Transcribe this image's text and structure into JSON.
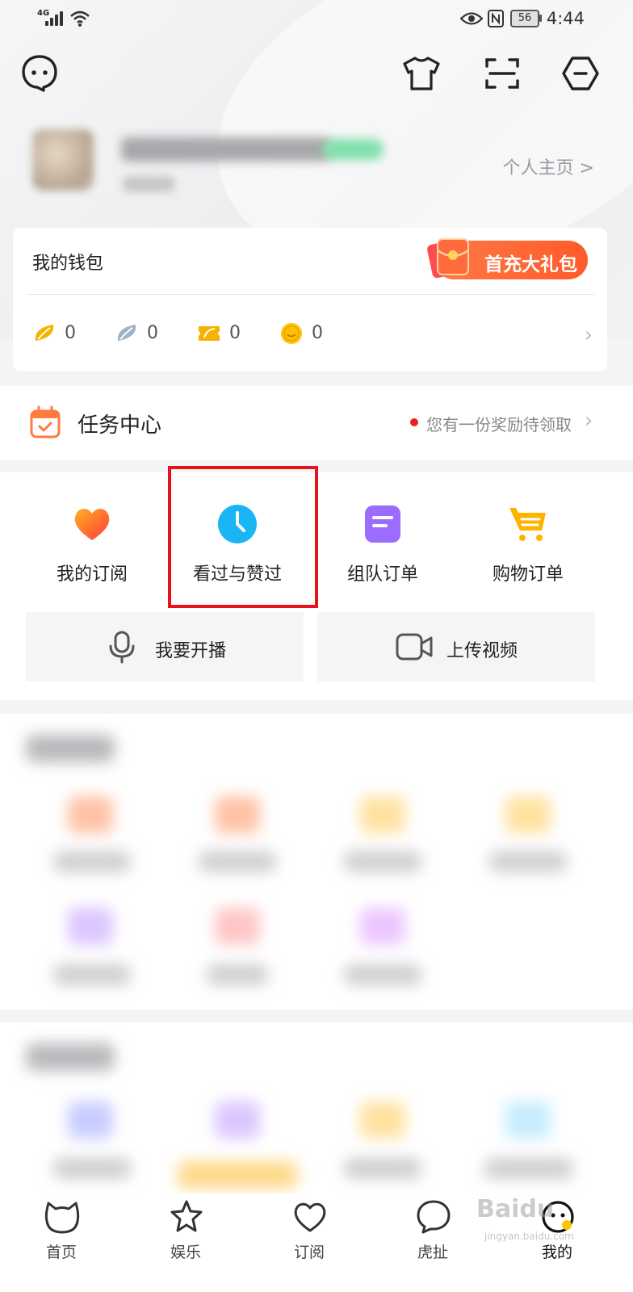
{
  "status_bar": {
    "network": "4G",
    "battery": "56",
    "time": "4:44"
  },
  "top_icons": [
    "chat-icon",
    "shirt-icon",
    "scan-icon",
    "settings-hex-icon"
  ],
  "profile": {
    "homepage_link": "个人主页 >"
  },
  "wallet": {
    "title": "我的钱包",
    "gift_button": "首充大礼包",
    "balances": [
      {
        "icon": "yellow-bean-icon",
        "value": "0"
      },
      {
        "icon": "silver-bean-icon",
        "value": "0"
      },
      {
        "icon": "coupon-icon",
        "value": "0"
      },
      {
        "icon": "gold-coin-icon",
        "value": "0"
      }
    ]
  },
  "task_center": {
    "title": "任务中心",
    "reward_notice": "您有一份奖励待领取"
  },
  "shortcuts": [
    {
      "label": "我的订阅",
      "icon": "heart-icon"
    },
    {
      "label": "看过与赞过",
      "icon": "clock-icon"
    },
    {
      "label": "组队订单",
      "icon": "document-icon"
    },
    {
      "label": "购物订单",
      "icon": "cart-icon"
    }
  ],
  "actions": [
    {
      "label": "我要开播",
      "icon": "microphone-icon"
    },
    {
      "label": "上传视频",
      "icon": "video-camera-icon"
    }
  ],
  "bottom_nav": [
    {
      "label": "首页",
      "icon": "home-cat-icon"
    },
    {
      "label": "娱乐",
      "icon": "star-icon"
    },
    {
      "label": "订阅",
      "icon": "heart-outline-icon"
    },
    {
      "label": "虎扯",
      "icon": "chat-bubble-icon"
    },
    {
      "label": "我的",
      "icon": "profile-face-icon"
    }
  ],
  "watermark": {
    "brand": "Baidu",
    "site": "jingyan.baidu.com"
  },
  "colors": {
    "accent_orange": "#ff6a2e",
    "highlight_red": "#e8131a",
    "reward_dot": "#e8231e"
  }
}
